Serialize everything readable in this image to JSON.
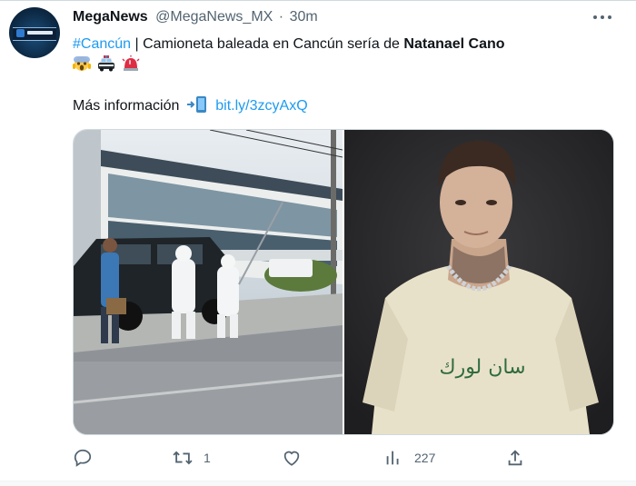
{
  "tweet": {
    "author_name": "MegaNews",
    "author_handle": "@MegaNews_MX",
    "separator": "·",
    "time": "30m",
    "avatar_text": "MEGA NEWS",
    "hashtag": "#Cancún",
    "text_body": " | Camioneta baleada en Cancún sería de ",
    "text_bold": "Natanael Cano",
    "emojis": [
      "scream-emoji",
      "police-car-emoji",
      "rotating-light-emoji"
    ],
    "more_info_label": "Más información",
    "more_info_icon": "mobile-phone-arrow-emoji",
    "link_text": "bit.ly/3zcyAxQ"
  },
  "media": {
    "left_photo": "crime-scene-photo",
    "right_photo": "portrait-photo",
    "shirt_text": "ﺳﺎﻥ ﻟﻮﺭﻙ"
  },
  "actions": {
    "reply": {
      "icon": "reply-icon",
      "count": ""
    },
    "retweet": {
      "icon": "retweet-icon",
      "count": "1"
    },
    "like": {
      "icon": "like-icon",
      "count": ""
    },
    "views": {
      "icon": "views-icon",
      "count": "227"
    },
    "share": {
      "icon": "share-icon",
      "count": ""
    }
  },
  "colors": {
    "accent": "#1d9bf0",
    "muted": "#536471",
    "text": "#0f1419"
  }
}
